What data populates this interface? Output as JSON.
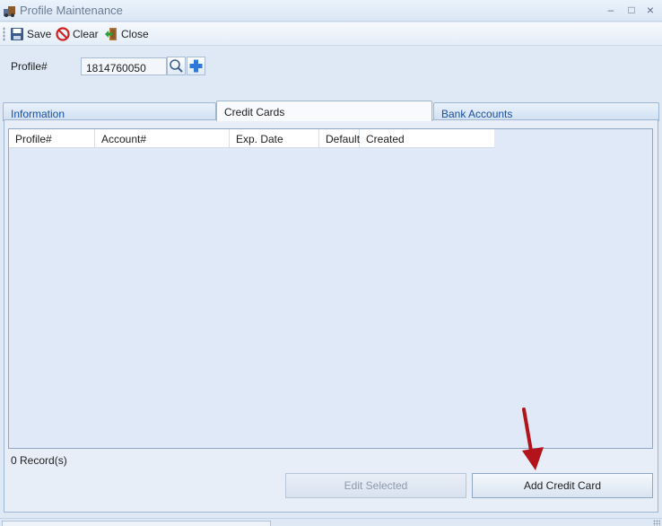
{
  "window": {
    "title": "Profile Maintenance",
    "icon": "app-icon",
    "minimize_glyph": "–",
    "maximize_glyph": "□",
    "close_glyph": "×"
  },
  "toolbar": {
    "save_label": "Save",
    "clear_label": "Clear",
    "close_label": "Close"
  },
  "profile": {
    "label": "Profile#",
    "value": "1814760050"
  },
  "tabs": [
    {
      "label": "Information",
      "active": false
    },
    {
      "label": "Credit Cards",
      "active": true
    },
    {
      "label": "Bank Accounts",
      "active": false
    }
  ],
  "grid": {
    "columns": [
      "Profile#",
      "Account#",
      "Exp. Date",
      "Default",
      "Created"
    ],
    "rows": []
  },
  "footer": {
    "record_count": "0 Record(s)",
    "edit_label": "Edit Selected",
    "add_label": "Add Credit Card"
  },
  "colors": {
    "annotation_arrow": "#b3141b",
    "accent": "#1a4fa0"
  }
}
